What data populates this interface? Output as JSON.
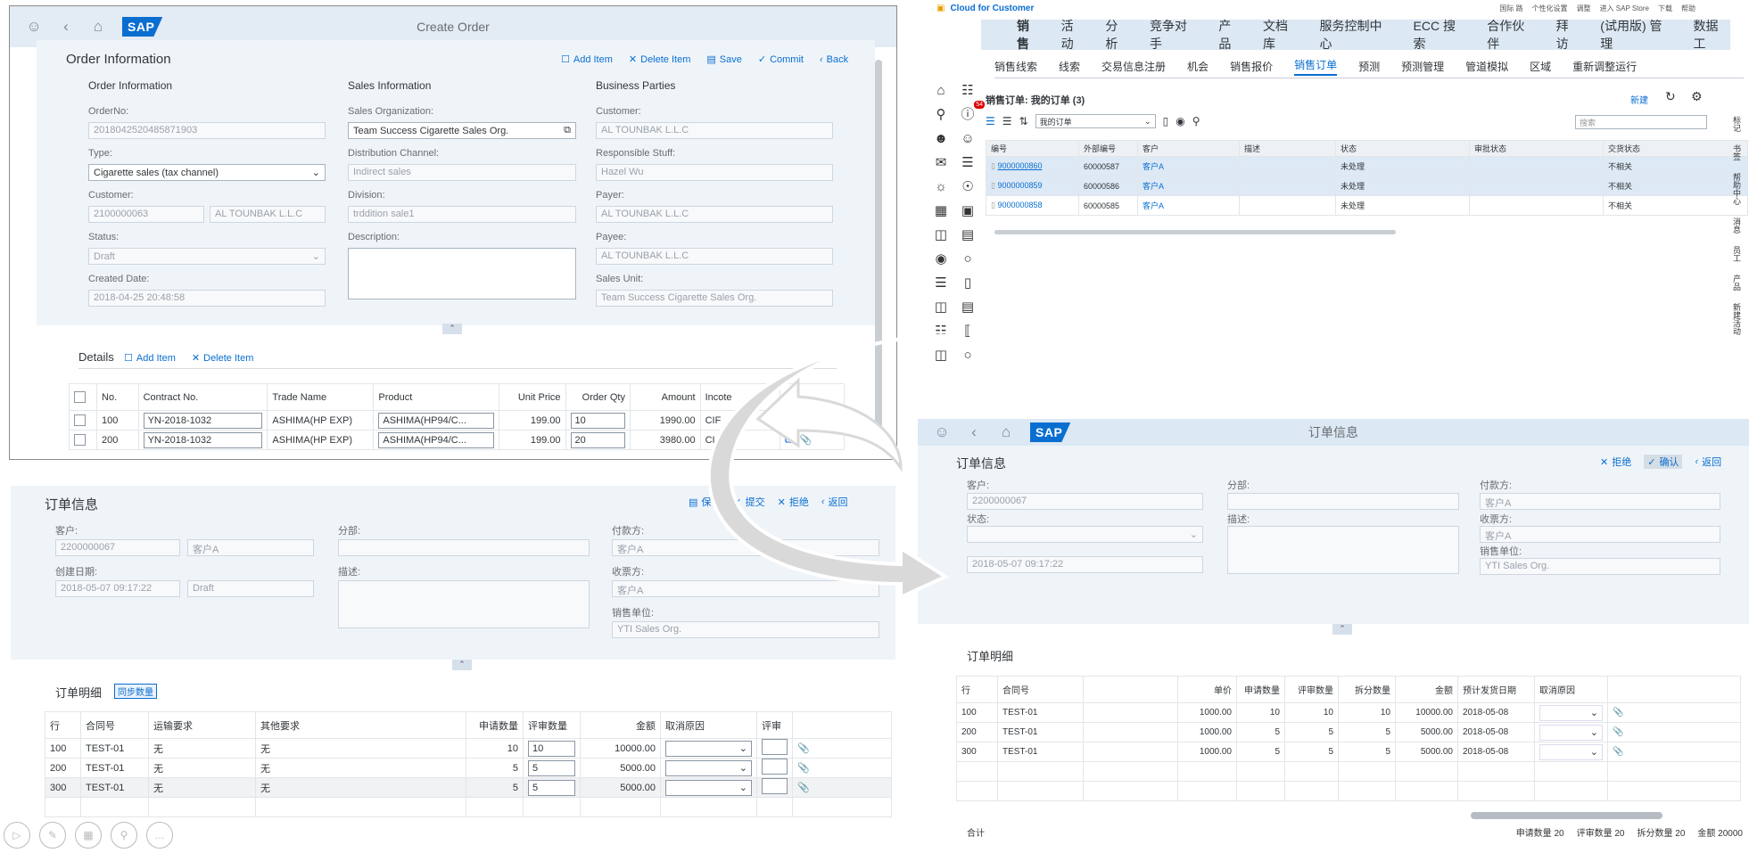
{
  "tl": {
    "title": "Create Order",
    "logo": "SAP",
    "page_title": "Order Information",
    "actions": [
      "Add Item",
      "Delete Item",
      "Save",
      "Commit",
      "Back"
    ],
    "sections": [
      "Order Information",
      "Sales Information",
      "Business Parties"
    ],
    "col1": [
      {
        "label": "OrderNo:",
        "value": "2018042520485871903"
      },
      {
        "label": "Type:",
        "value": "Cigarette sales (tax channel)"
      },
      {
        "label": "Customer:",
        "value": "2100000063",
        "value2": "AL TOUNBAK L.L.C"
      },
      {
        "label": "Status:",
        "value": "Draft"
      },
      {
        "label": "Created Date:",
        "value": "2018-04-25 20:48:58"
      }
    ],
    "col2": [
      {
        "label": "Sales Organization:",
        "value": "Team Success Cigarette Sales Org."
      },
      {
        "label": "Distribution Channel:",
        "value": "Indirect sales"
      },
      {
        "label": "Division:",
        "value": "trddition sale1"
      },
      {
        "label": "Description:",
        "value": ""
      }
    ],
    "col3": [
      {
        "label": "Customer:",
        "value": "AL TOUNBAK L.L.C"
      },
      {
        "label": "Responsible Stuff:",
        "value": "Hazel Wu"
      },
      {
        "label": "Payer:",
        "value": "AL TOUNBAK L.L.C"
      },
      {
        "label": "Payee:",
        "value": "AL TOUNBAK L.L.C"
      },
      {
        "label": "Sales Unit:",
        "value": "Team Success Cigarette Sales Org."
      }
    ],
    "details_title": "Details",
    "details_actions": [
      "Add Item",
      "Delete Item"
    ],
    "columns": [
      "No.",
      "Contract No.",
      "Trade Name",
      "Product",
      "Unit Price",
      "Order Qty",
      "Amount",
      "Incote"
    ],
    "rows": [
      {
        "no": "100",
        "contract": "YN-2018-1032",
        "trade": "ASHIMA(HP EXP)",
        "product": "ASHIMA(HP94/C...",
        "price": "199.00",
        "qty": "10",
        "amount": "1990.00",
        "inc": "CIF"
      },
      {
        "no": "200",
        "contract": "YN-2018-1032",
        "trade": "ASHIMA(HP EXP)",
        "product": "ASHIMA(HP94/C...",
        "price": "199.00",
        "qty": "20",
        "amount": "3980.00",
        "inc": "CI"
      }
    ]
  },
  "tr": {
    "brand": "Cloud for Customer",
    "top_links": [
      "国际 路",
      "个性化设置",
      "调整",
      "进入 SAP Store",
      "下载",
      "帮助"
    ],
    "nav": [
      "销售",
      "活动",
      "分析",
      "竞争对手",
      "产品",
      "文档库",
      "服务控制中心",
      "ECC 搜索",
      "合作伙伴",
      "拜访",
      "(试用版) 管理",
      "数据工"
    ],
    "subnav": [
      "销售线索",
      "线索",
      "交易信息注册",
      "机会",
      "销售报价",
      "销售订单",
      "预测",
      "预测管理",
      "管道模拟",
      "区域",
      "重新调整运行"
    ],
    "list_title": "销售订单: 我的订单 (3)",
    "new_btn": "新建",
    "view_select": "我的订单",
    "search_placeholder": "搜索",
    "badge": "54",
    "columns": [
      "编号",
      "外部编号",
      "客户",
      "描述",
      "状态",
      "审批状态",
      "交货状态"
    ],
    "rows": [
      {
        "id": "9000000860",
        "ext": "60000587",
        "cust": "客户A",
        "desc": "",
        "status": "未处理",
        "appr": "",
        "deliv": "不相关"
      },
      {
        "id": "9000000859",
        "ext": "60000586",
        "cust": "客户A",
        "desc": "",
        "status": "未处理",
        "appr": "",
        "deliv": "不相关"
      },
      {
        "id": "9000000858",
        "ext": "60000585",
        "cust": "客户A",
        "desc": "",
        "status": "未处理",
        "appr": "",
        "deliv": "不相关"
      }
    ],
    "right_side": [
      "标记",
      "书签",
      "帮助中心",
      "消息",
      "员工",
      "产品",
      "新建活动"
    ]
  },
  "bl": {
    "page_title": "订单信息",
    "actions": [
      "保存",
      "提交",
      "拒绝",
      "返回"
    ],
    "fields": {
      "customer_label": "客户:",
      "customer": "2200000067",
      "customer2": "客户A",
      "created_label": "创建日期:",
      "created": "2018-05-07 09:17:22",
      "created2": "Draft",
      "division_label": "分部:",
      "desc_label": "描述:",
      "payer_label": "付款方:",
      "payer": "客户A",
      "payee_label": "收票方:",
      "payee": "客户A",
      "unit_label": "销售单位:",
      "unit": "YTI Sales Org."
    },
    "details_title": "订单明细",
    "sync_btn": "同步数量",
    "columns": [
      "行",
      "合同号",
      "运输要求",
      "其他要求",
      "申请数量",
      "评审数量",
      "金额",
      "取消原因",
      "评审"
    ],
    "rows": [
      {
        "row": "100",
        "contract": "TEST-01",
        "ship": "无",
        "other": "无",
        "req": "10",
        "rev": "10",
        "amt": "10000.00"
      },
      {
        "row": "200",
        "contract": "TEST-01",
        "ship": "无",
        "other": "无",
        "req": "5",
        "rev": "5",
        "amt": "5000.00"
      },
      {
        "row": "300",
        "contract": "TEST-01",
        "ship": "无",
        "other": "无",
        "req": "5",
        "rev": "5",
        "amt": "5000.00"
      }
    ]
  },
  "br": {
    "title": "订单信息",
    "logo": "SAP",
    "page_title": "订单信息",
    "actions": [
      "拒绝",
      "确认",
      "返回"
    ],
    "fields": {
      "customer_label": "客户:",
      "customer": "2200000067",
      "status_label": "状态:",
      "created": "2018-05-07 09:17:22",
      "division_label": "分部:",
      "desc_label": "描述:",
      "payer_label": "付款方:",
      "payer": "客户A",
      "payee_label": "收票方:",
      "payee": "客户A",
      "unit_label": "销售单位:",
      "unit": "YTI Sales Org."
    },
    "details_title": "订单明细",
    "columns": [
      "行",
      "合同号",
      "",
      "单价",
      "申请数量",
      "评审数量",
      "拆分数量",
      "金额",
      "预计发货日期",
      "取消原因"
    ],
    "rows": [
      {
        "row": "100",
        "contract": "TEST-01",
        "price": "1000.00",
        "req": "10",
        "rev": "10",
        "split": "10",
        "amt": "10000.00",
        "date": "2018-05-08"
      },
      {
        "row": "200",
        "contract": "TEST-01",
        "price": "1000.00",
        "req": "5",
        "rev": "5",
        "split": "5",
        "amt": "5000.00",
        "date": "2018-05-08"
      },
      {
        "row": "300",
        "contract": "TEST-01",
        "price": "1000.00",
        "req": "5",
        "rev": "5",
        "split": "5",
        "amt": "5000.00",
        "date": "2018-05-08"
      }
    ],
    "footer": {
      "label": "合计",
      "req": "申请数量 20",
      "rev": "评审数量 20",
      "split": "拆分数量 20",
      "amt": "金额 20000"
    }
  }
}
